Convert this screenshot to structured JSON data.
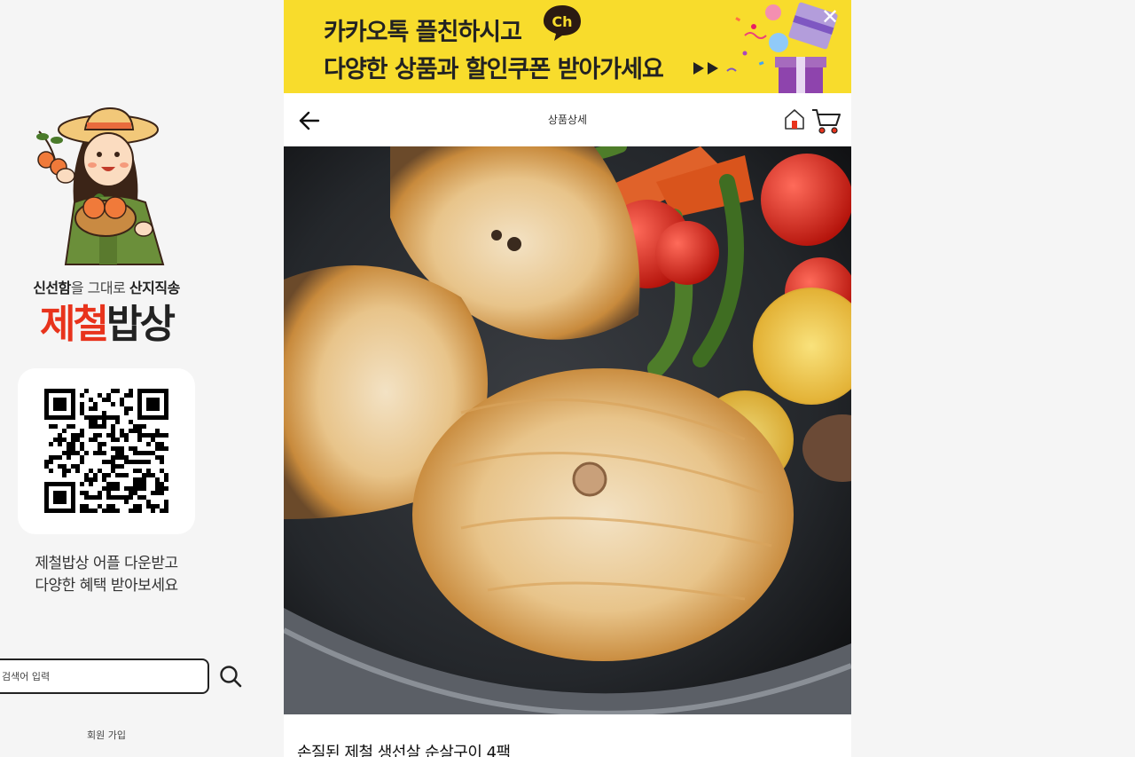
{
  "left_panel": {
    "tagline_part1": "신선함",
    "tagline_part2": "을 그대로 ",
    "tagline_part3": "산지직송",
    "brand_part1": "제철",
    "brand_part2": "밥상",
    "app_promo_line1": "제철밥상 어플 다운받고",
    "app_promo_line2": "다양한 혜택 받아보세요",
    "search_placeholder": "검색어 입력",
    "footer_link": "회원 가입"
  },
  "banner": {
    "line1": "카카오톡 플친하시고",
    "line2": "다양한 상품과 할인쿠폰 받아가세요",
    "badge_text": "Ch",
    "close_label": "✕"
  },
  "nav": {
    "title": "상품상세"
  },
  "product": {
    "title": "손질된 제철 생선살 순살구이 4팩"
  },
  "colors": {
    "banner_bg": "#f8dc2c",
    "brand_red": "#e8331c",
    "page_bg": "#f5f5f5"
  }
}
